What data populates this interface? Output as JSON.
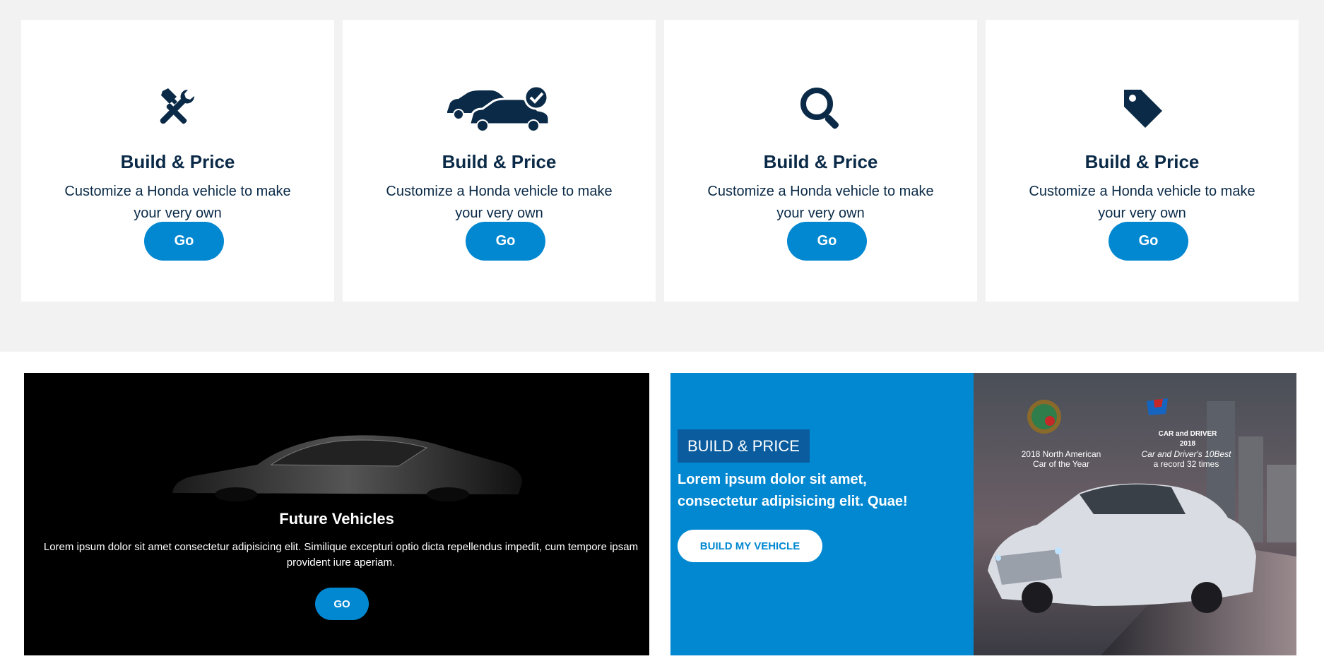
{
  "cards": [
    {
      "icon": "tools-icon",
      "title": "Build & Price",
      "desc": "Customize a Honda vehicle to make your very own",
      "button": "Go"
    },
    {
      "icon": "cars-check-icon",
      "title": "Build & Price",
      "desc": "Customize a Honda vehicle to make your very own",
      "button": "Go"
    },
    {
      "icon": "search-icon",
      "title": "Build & Price",
      "desc": "Customize a Honda vehicle to make your very own",
      "button": "Go"
    },
    {
      "icon": "tag-icon",
      "title": "Build & Price",
      "desc": "Customize a Honda vehicle to make your very own",
      "button": "Go"
    }
  ],
  "future": {
    "title": "Future Vehicles",
    "desc": "Lorem ipsum dolor sit amet consectetur adipisicing elit. Similique excepturi optio dicta repellendus impedit, cum tempore ipsam provident iure aperiam.",
    "button": "GO"
  },
  "promo": {
    "badge": "BUILD & PRICE",
    "text": "Lorem ipsum dolor sit amet, consectetur adipisicing elit. Quae!",
    "button": "BUILD MY VEHICLE",
    "award1": {
      "line1": "2018 North American",
      "line2": "Car of the Year"
    },
    "award2": {
      "logo_top": "10Best",
      "logo": "CAR and DRIVER",
      "year": "2018",
      "line1": "Car and Driver's 10Best",
      "line2": "a record 32 times"
    }
  },
  "colors": {
    "accent": "#0288d1",
    "navy": "#0a2a47",
    "band": "#f2f2f2"
  }
}
